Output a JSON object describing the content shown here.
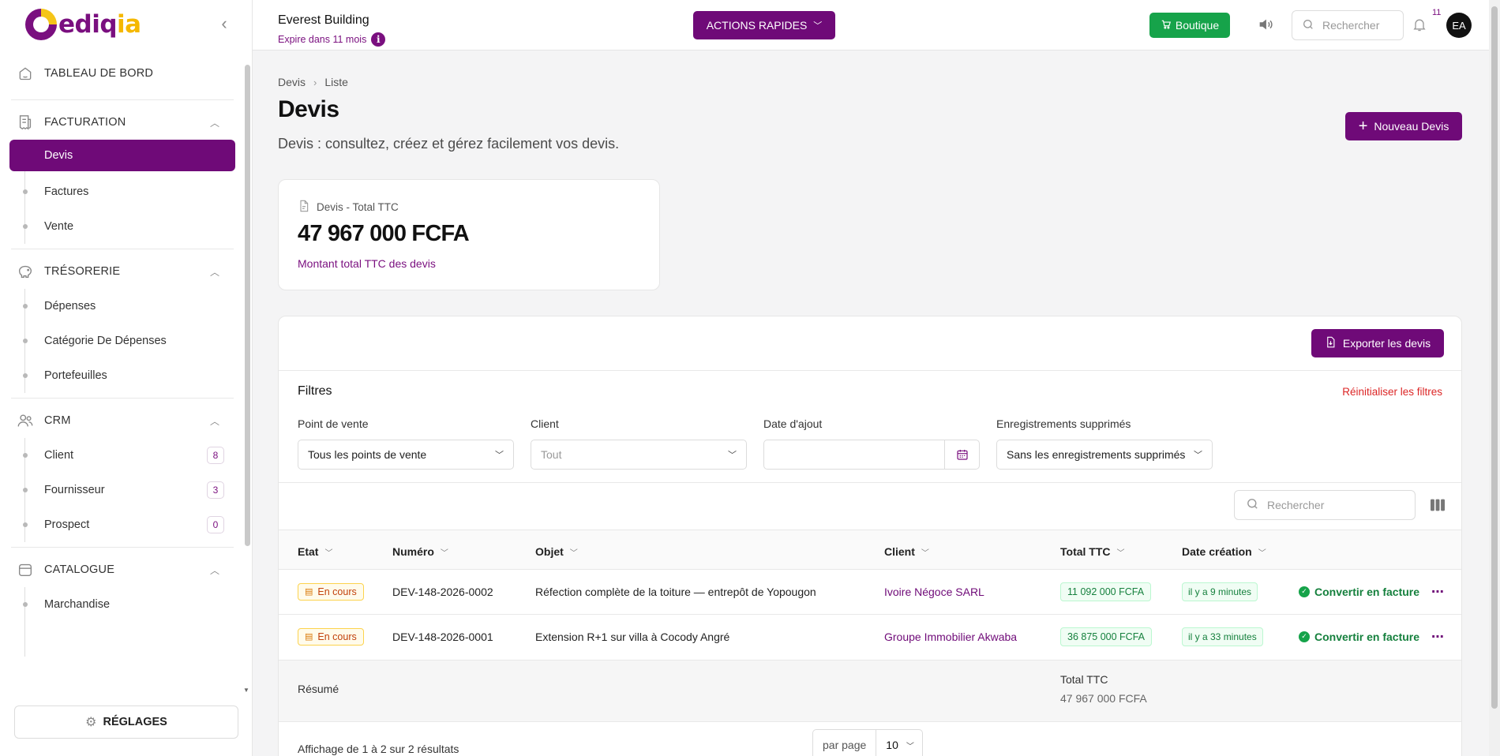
{
  "brand": {
    "logo_main": "ediq",
    "logo_accent": "ia"
  },
  "header": {
    "company_name": "Everest Building",
    "expire_text": "Expire dans 11 mois",
    "info_glyph": "i",
    "quick_actions_label": "ACTIONS RAPIDES",
    "shop_label": "Boutique",
    "search_placeholder": "Rechercher",
    "notification_count": "11",
    "avatar_initials": "EA"
  },
  "sidebar": {
    "dashboard_label": "TABLEAU DE BORD",
    "groups": [
      {
        "label": "FACTURATION",
        "items": [
          {
            "label": "Devis",
            "active": true
          },
          {
            "label": "Factures"
          },
          {
            "label": "Vente"
          }
        ]
      },
      {
        "label": "TRÉSORERIE",
        "items": [
          {
            "label": "Dépenses"
          },
          {
            "label": "Catégorie De Dépenses"
          },
          {
            "label": "Portefeuilles"
          }
        ]
      },
      {
        "label": "CRM",
        "items": [
          {
            "label": "Client",
            "count": "8"
          },
          {
            "label": "Fournisseur",
            "count": "3"
          },
          {
            "label": "Prospect",
            "count": "0"
          }
        ]
      },
      {
        "label": "CATALOGUE",
        "items": [
          {
            "label": "Marchandise"
          }
        ]
      }
    ],
    "settings_label": "RÉGLAGES"
  },
  "page": {
    "breadcrumb": [
      "Devis",
      "Liste"
    ],
    "title": "Devis",
    "subtitle": "Devis : consultez, créez et gérez facilement vos devis.",
    "new_button": "Nouveau Devis"
  },
  "stat": {
    "label": "Devis - Total TTC",
    "value": "47 967 000 FCFA",
    "description": "Montant total TTC des devis"
  },
  "panel": {
    "export_button": "Exporter les devis",
    "filters_title": "Filtres",
    "reset_label": "Réinitialiser les filtres",
    "filters": {
      "point_of_sale": {
        "label": "Point de vente",
        "value": "Tous les points de vente"
      },
      "client": {
        "label": "Client",
        "placeholder": "Tout"
      },
      "date_added": {
        "label": "Date d'ajout",
        "value": ""
      },
      "deleted": {
        "label": "Enregistrements supprimés",
        "value": "Sans les enregistrements supprimés"
      }
    },
    "table_search_placeholder": "Rechercher"
  },
  "table": {
    "columns": [
      "Etat",
      "Numéro",
      "Objet",
      "Client",
      "Total TTC",
      "Date création"
    ],
    "rows": [
      {
        "status": "En cours",
        "number": "DEV-148-2026-0002",
        "object": "Réfection complète de la toiture — entrepôt de Yopougon",
        "client": "Ivoire Négoce SARL",
        "total": "11 092 000 FCFA",
        "created": "il y a 9 minutes",
        "action": "Convertir en facture"
      },
      {
        "status": "En cours",
        "number": "DEV-148-2026-0001",
        "object": "Extension R+1 sur villa à Cocody Angré",
        "client": "Groupe Immobilier Akwaba",
        "total": "36 875 000 FCFA",
        "created": "il y a 33 minutes",
        "action": "Convertir en facture"
      }
    ],
    "summary_label": "Résumé",
    "summary_total_label": "Total TTC",
    "summary_total_value": "47 967 000 FCFA"
  },
  "pagination": {
    "info": "Affichage de 1 à 2 sur 2 résultats",
    "per_page_label": "par page",
    "per_page_value": "10"
  },
  "colors": {
    "brand": "#6f0a78",
    "accent": "#f5b800",
    "success": "#16a34a",
    "danger": "#dc2626"
  }
}
